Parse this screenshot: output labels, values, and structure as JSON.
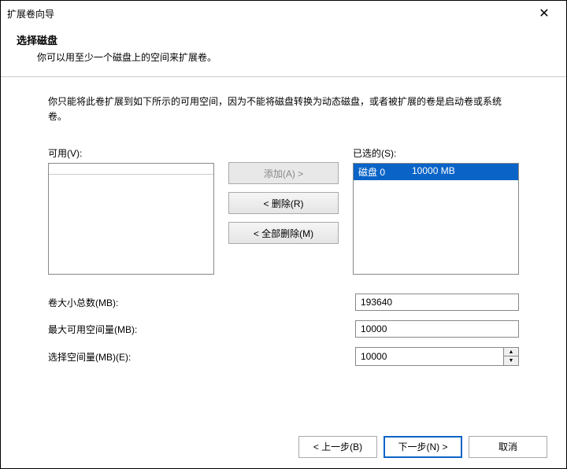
{
  "window": {
    "title": "扩展卷向导"
  },
  "header": {
    "title": "选择磁盘",
    "desc": "你可以用至少一个磁盘上的空间来扩展卷。"
  },
  "body": {
    "info": "你只能将此卷扩展到如下所示的可用空间，因为不能将磁盘转换为动态磁盘，或者被扩展的卷是启动卷或系统卷。",
    "available_label": "可用(V):",
    "selected_label": "已选的(S):",
    "selected_item": {
      "disk": "磁盘 0",
      "size": "10000 MB"
    },
    "btn_add": "添加(A) >",
    "btn_remove": "< 删除(R)",
    "btn_remove_all": "< 全部删除(M)",
    "total_label": "卷大小总数(MB):",
    "total_value": "193640",
    "max_label": "最大可用空间量(MB):",
    "max_value": "10000",
    "select_label": "选择空间量(MB)(E):",
    "select_value": "10000"
  },
  "footer": {
    "back": "< 上一步(B)",
    "next": "下一步(N) >",
    "cancel": "取消"
  }
}
